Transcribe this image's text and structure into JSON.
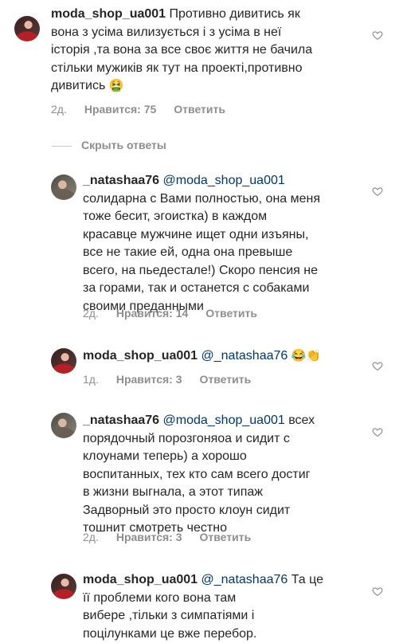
{
  "comments": [
    {
      "user": "moda_shop_ua001",
      "mention": "",
      "text_line1": " Противно дивитись як",
      "lines": [
        "вона з усіма вилизується і з усіма в неї",
        "історія ,та вона за все своє життя не бачила",
        "стільки мужиків як тут на проекті,противно",
        "дивитись"
      ],
      "emoji": "🤮",
      "time": "2д.",
      "likes": "Нравится: 75",
      "reply": "Ответить"
    },
    {
      "user": "_natashaa76",
      "mention": "@moda_shop_ua001",
      "text_line1": "",
      "lines": [
        "солидарна с Вами полностью, она меня",
        "тоже бесит, эгоистка) в каждом",
        "красавце мужчине ищет одни изъяны,",
        "все не такие ей, одна она превыше",
        "всего, на пьедестале!) Скоро пенсия не",
        "за горами, так и останется с собаками",
        "своими преданными"
      ],
      "emoji": "",
      "time": "2д.",
      "likes": "Нравится: 14",
      "reply": "Ответить"
    },
    {
      "user": "moda_shop_ua001",
      "mention": "@_natashaa76",
      "text_line1": "",
      "lines": [],
      "emoji": "😂👏",
      "time": "1д.",
      "likes": "Нравится: 3",
      "reply": "Ответить"
    },
    {
      "user": "_natashaa76",
      "mention": "@moda_shop_ua001",
      "text_line1": " всех",
      "lines": [
        "порядочный порозгоняоа и сидит с",
        "клоунами теперь) а хорошо",
        "воспитанных, тех кто сам всего достиг",
        "в жизни выгнала, а этот типаж",
        "Задворный это просто клоун сидит",
        "тошнит смотреть честно"
      ],
      "emoji": "",
      "time": "2д.",
      "likes": "Нравится: 3",
      "reply": "Ответить"
    },
    {
      "user": "moda_shop_ua001",
      "mention": "@_natashaa76",
      "text_line1": " Та це",
      "lines": [
        "її проблеми кого вона там",
        "вибере ,тільки з симпатіями і",
        "поцілунками це вже перебор."
      ],
      "emoji": "",
      "time": "",
      "likes": "",
      "reply": ""
    }
  ],
  "hide_replies": "Скрыть ответы",
  "icons": {
    "like": "heart-outline-icon"
  },
  "colors": {
    "text": "#262626",
    "meta": "#8e8e8e",
    "mention": "#00376b"
  }
}
